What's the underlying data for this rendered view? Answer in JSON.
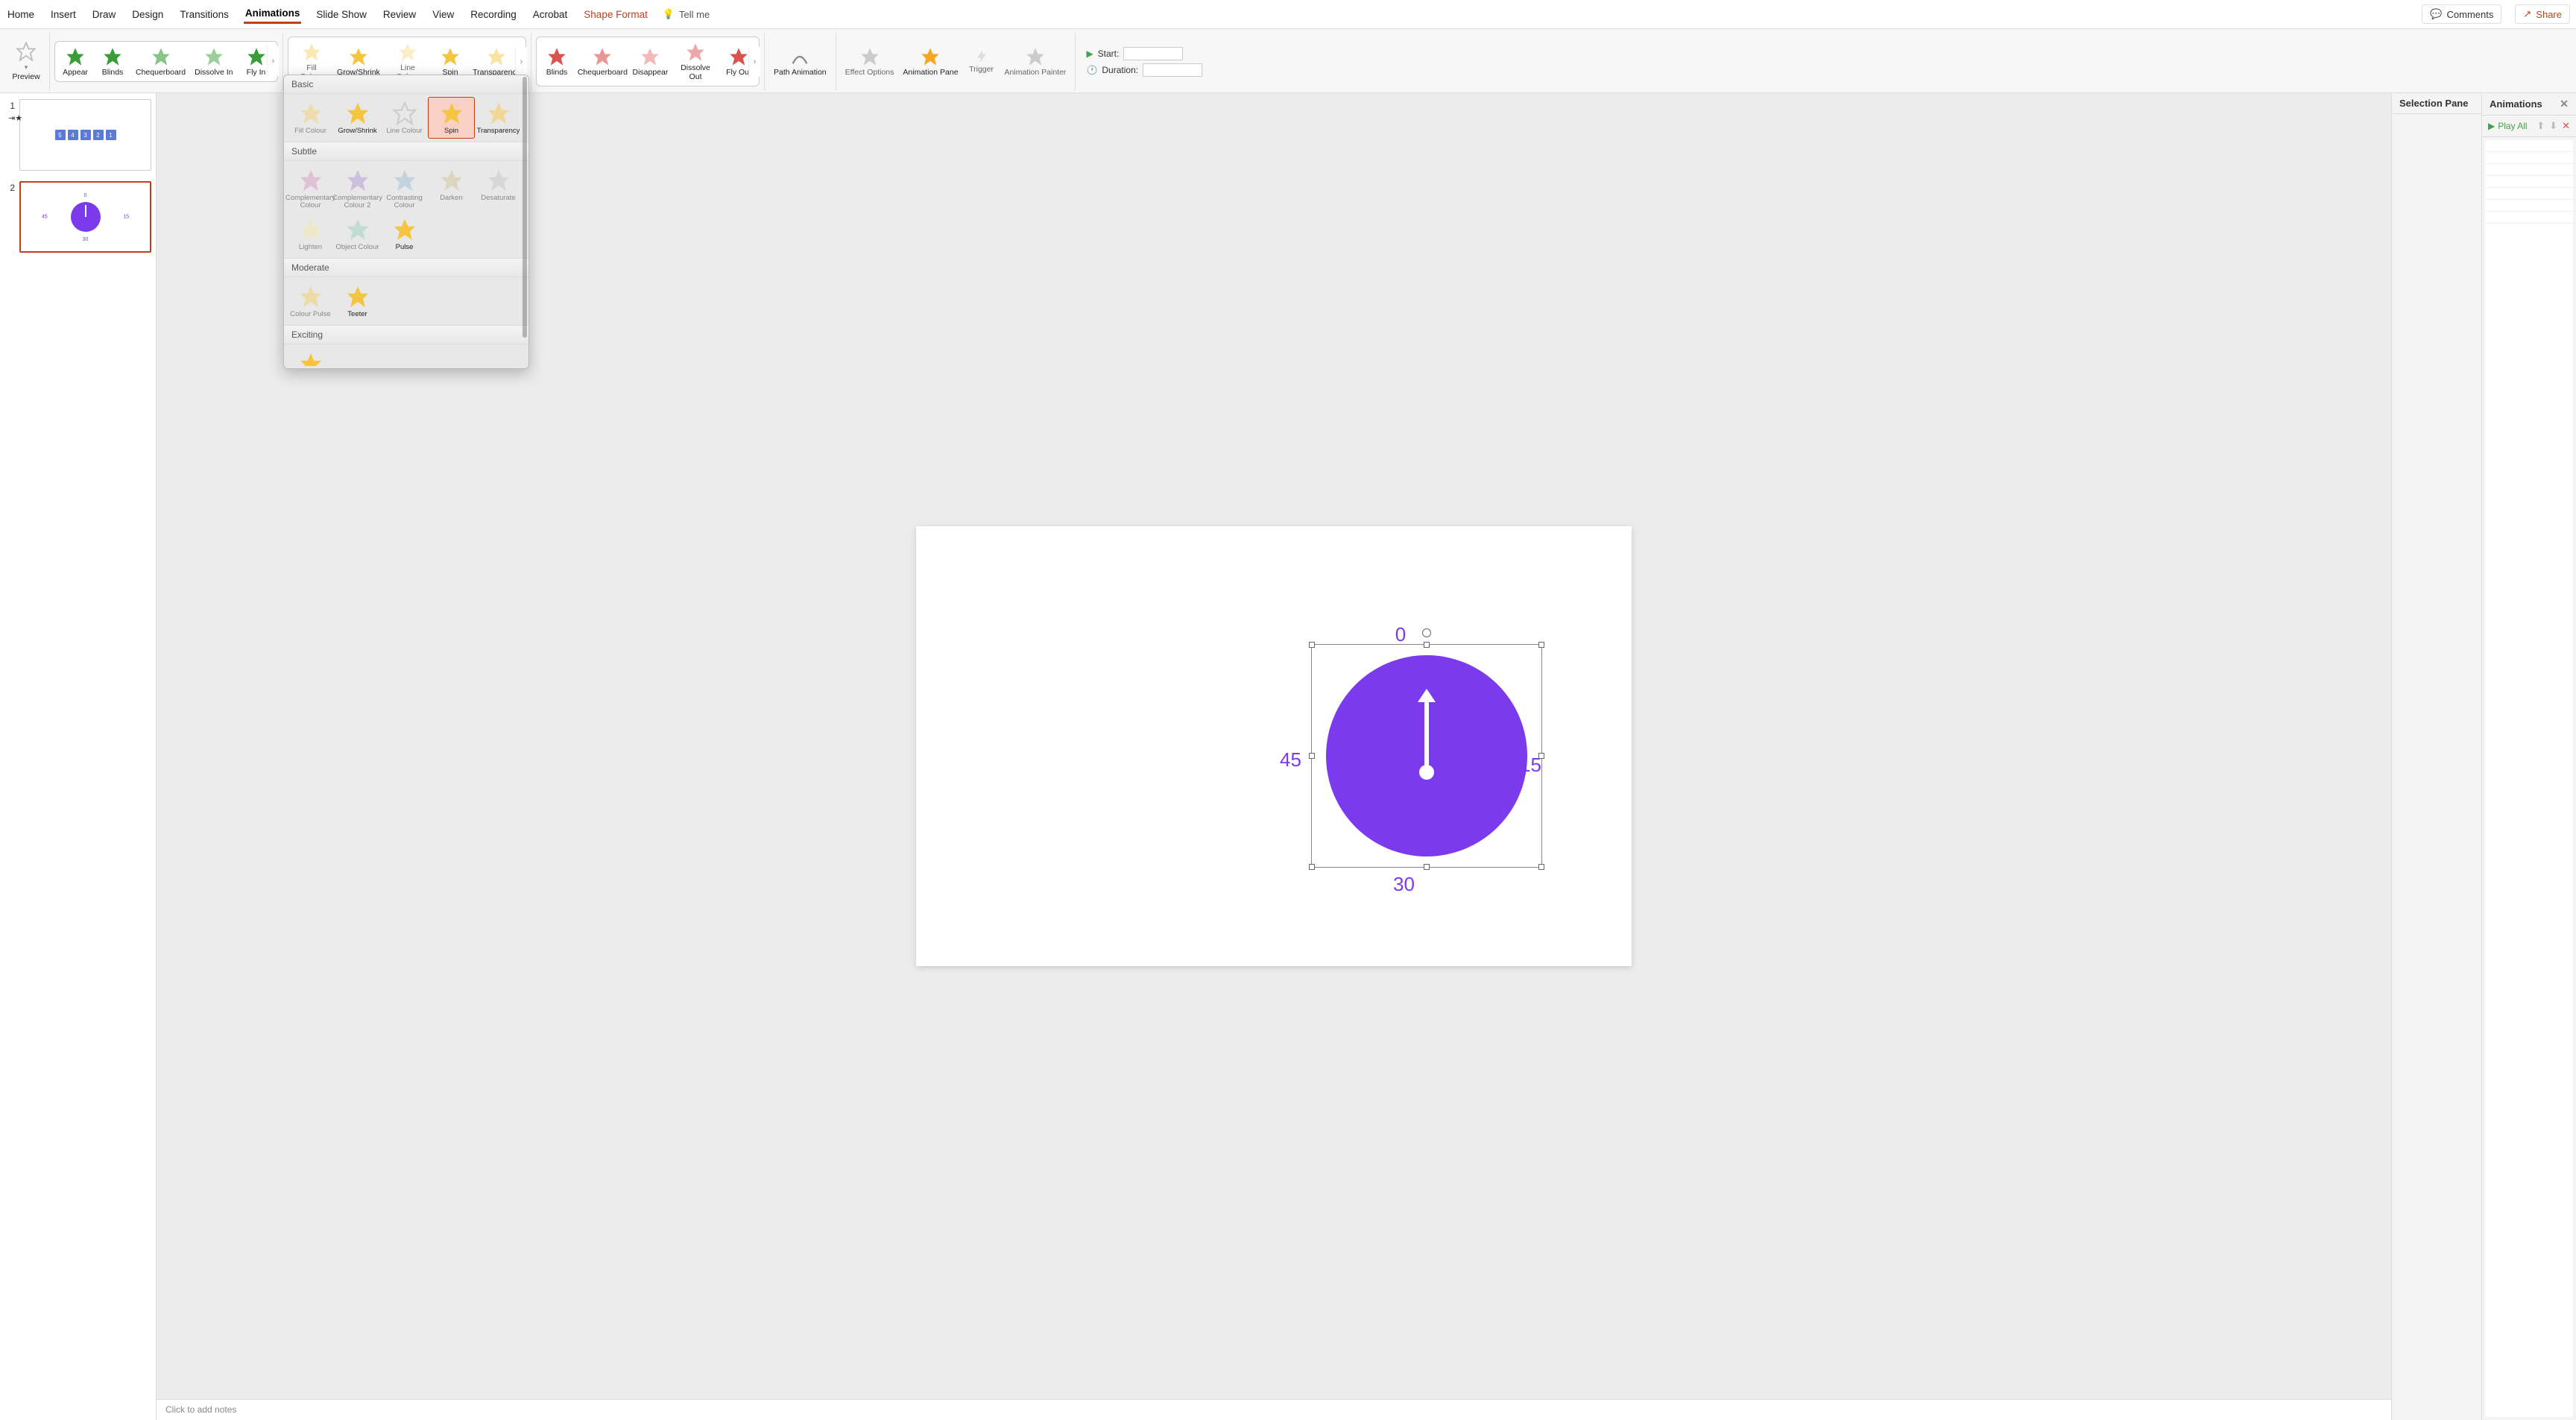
{
  "menu": {
    "tabs": [
      "Home",
      "Insert",
      "Draw",
      "Design",
      "Transitions",
      "Animations",
      "Slide Show",
      "Review",
      "View",
      "Recording",
      "Acrobat",
      "Shape Format"
    ],
    "activeTab": "Animations",
    "tellMe": "Tell me",
    "comments": "Comments",
    "share": "Share"
  },
  "ribbon": {
    "preview": "Preview",
    "entrance": [
      "Appear",
      "Blinds",
      "Chequerboard",
      "Dissolve In",
      "Fly In"
    ],
    "emphasis": [
      "Fill Colour",
      "Grow/Shrink",
      "Line Colour",
      "Spin",
      "Transparency"
    ],
    "exit": [
      "Blinds",
      "Chequerboard",
      "Disappear",
      "Dissolve Out",
      "Fly Out"
    ],
    "path": "Path Animation",
    "controls": [
      "Effect Options",
      "Animation Pane",
      "Trigger",
      "Animation Painter"
    ],
    "timing": {
      "startLabel": "Start:",
      "durationLabel": "Duration:"
    }
  },
  "dropdown": {
    "categories": {
      "basic": {
        "title": "Basic",
        "items": [
          "Fill Colour",
          "Grow/Shrink",
          "Line Colour",
          "Spin",
          "Transparency"
        ],
        "selected": "Spin",
        "boldItems": [
          "Grow/Shrink",
          "Spin",
          "Transparency"
        ]
      },
      "subtle": {
        "title": "Subtle",
        "items": [
          "Complementary Colour",
          "Complementary Colour 2",
          "Contrasting Colour",
          "Darken",
          "Desaturate",
          "Lighten",
          "Object Colour",
          "Pulse"
        ],
        "boldItems": [
          "Pulse"
        ]
      },
      "moderate": {
        "title": "Moderate",
        "items": [
          "Colour Pulse",
          "Teeter"
        ],
        "boldItems": [
          "Teeter"
        ]
      },
      "exciting": {
        "title": "Exciting",
        "items": []
      }
    }
  },
  "slides": {
    "thumb1boxes": [
      "5",
      "4",
      "3",
      "2",
      "1"
    ],
    "clockLabels": {
      "top": "0",
      "right": "15",
      "bottom": "30",
      "left": "45"
    },
    "notesPlaceholder": "Click to add notes"
  },
  "rightPanes": {
    "selection": "Selection Pane",
    "animations": "Animations",
    "playAll": "Play All"
  }
}
